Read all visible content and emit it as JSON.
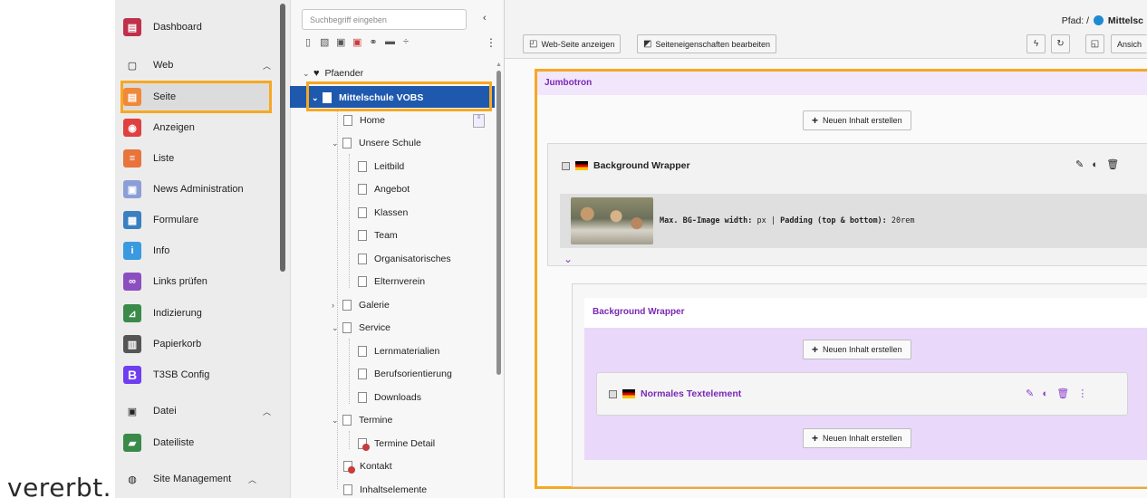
{
  "caption": "vererbt.",
  "module_menu": {
    "items": [
      {
        "label": "Dashboard",
        "icon": "dashboard-icon",
        "color": "#c0304a"
      },
      {
        "label": "Web",
        "icon": "web-page-icon",
        "color": ""
      },
      {
        "label": "Seite",
        "icon": "page-module-icon",
        "color": "#f0893a"
      },
      {
        "label": "Anzeigen",
        "icon": "eye-icon",
        "color": "#e04040"
      },
      {
        "label": "Liste",
        "icon": "list-icon",
        "color": "#e8743c"
      },
      {
        "label": "News Administration",
        "icon": "news-icon",
        "color": "#8c9ed8"
      },
      {
        "label": "Formulare",
        "icon": "form-icon",
        "color": "#3a7fc1"
      },
      {
        "label": "Info",
        "icon": "info-icon",
        "color": "#3a9ae0"
      },
      {
        "label": "Links prüfen",
        "icon": "link-check-icon",
        "color": "#8c4fc0"
      },
      {
        "label": "Indizierung",
        "icon": "indexing-icon",
        "color": "#3a8a4a"
      },
      {
        "label": "Papierkorb",
        "icon": "trash-icon",
        "color": "#555555"
      },
      {
        "label": "T3SB Config",
        "icon": "bootstrap-icon",
        "color": "#6f3ef0"
      },
      {
        "label": "Datei",
        "icon": "file-image-icon",
        "color": ""
      },
      {
        "label": "Dateiliste",
        "icon": "filelist-icon",
        "color": "#3a8a4a"
      },
      {
        "label": "Site Management",
        "icon": "globe-icon",
        "color": ""
      }
    ]
  },
  "tree": {
    "search_placeholder": "Suchbegriff eingeben",
    "root": "Pfaender",
    "selected": "Mittelschule VOBS",
    "nodes": {
      "home": "Home",
      "unsere_schule": "Unsere Schule",
      "leitbild": "Leitbild",
      "angebot": "Angebot",
      "klassen": "Klassen",
      "team": "Team",
      "organisatorisches": "Organisatorisches",
      "elternverein": "Elternverein",
      "galerie": "Galerie",
      "service": "Service",
      "lernmaterialien": "Lernmaterialien",
      "berufsorientierung": "Berufsorientierung",
      "downloads": "Downloads",
      "termine": "Termine",
      "termine_detail": "Termine Detail",
      "kontakt": "Kontakt",
      "inhaltselemente": "Inhaltselemente"
    }
  },
  "content": {
    "path_label": "Pfad: /",
    "path_page": "Mittelsc",
    "btn_view": "Web-Seite anzeigen",
    "btn_props": "Seiteneigenschaften bearbeiten",
    "btn_view_mode": "Ansich",
    "jumbotron": "Jumbotron",
    "new_content": "Neuen Inhalt erstellen",
    "bg_wrapper": "Background Wrapper",
    "preview_prefix": "Max. BG-Image width:",
    "preview_value1": "px |",
    "preview_mid": "Padding (top & bottom):",
    "preview_value2": "20rem",
    "inner_wrapper": "Background Wrapper",
    "text_element": "Normales Textelement"
  },
  "colors": {
    "highlight": "#f7a823",
    "selected_node": "#1e59ad",
    "purple": "#7a28b5"
  }
}
